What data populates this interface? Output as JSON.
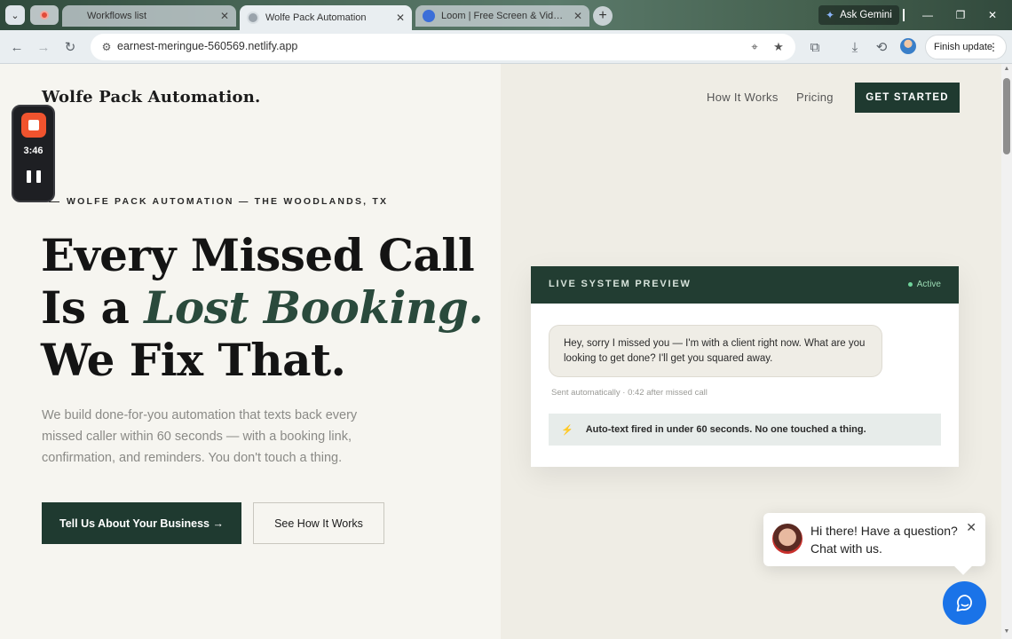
{
  "browser": {
    "tabs": [
      {
        "label": "Workflows list",
        "active": false
      },
      {
        "label": "Wolfe Pack Automation",
        "active": true
      },
      {
        "label": "Loom | Free Screen & Video Re",
        "active": false
      }
    ],
    "ask_gemini": "Ask Gemini",
    "url": "earnest-meringue-560569.netlify.app",
    "finish_update": "Finish update"
  },
  "site": {
    "brand": "Wolfe Pack Automation.",
    "nav": [
      "How It Works",
      "Pricing"
    ],
    "cta": "GET STARTED"
  },
  "hero": {
    "eyebrow": "WOLFE PACK AUTOMATION — THE WOODLANDS, TX",
    "headline_line1": "Every Missed Call",
    "headline_line2_prefix": "Is a ",
    "headline_line2_em": "Lost Booking.",
    "headline_line3": "We Fix That.",
    "subtext": "We build done-for-you automation that texts back every missed caller within 60 seconds — with a booking link, confirmation, and reminders. You don't touch a thing.",
    "primary_button": "Tell Us About Your Business →",
    "secondary_button": "See How It Works"
  },
  "preview": {
    "title": "LIVE SYSTEM PREVIEW",
    "status": "Active",
    "message": "Hey, sorry I missed you — I'm with a client right now. What are you looking to get done? I'll get you squared away.",
    "meta": "Sent automatically · 0:42 after missed call",
    "alert": "Auto-text fired in under 60 seconds. No one touched a thing."
  },
  "recorder": {
    "time": "3:46"
  },
  "chat": {
    "message_line1": "Hi there! Have a question?",
    "message_line2": "Chat with us."
  },
  "colors": {
    "brand_green": "#1f3a30",
    "accent_green": "#2a4a3c",
    "status_green": "#6fd49b",
    "chat_blue": "#1a73e8",
    "record_orange": "#f0532e"
  }
}
